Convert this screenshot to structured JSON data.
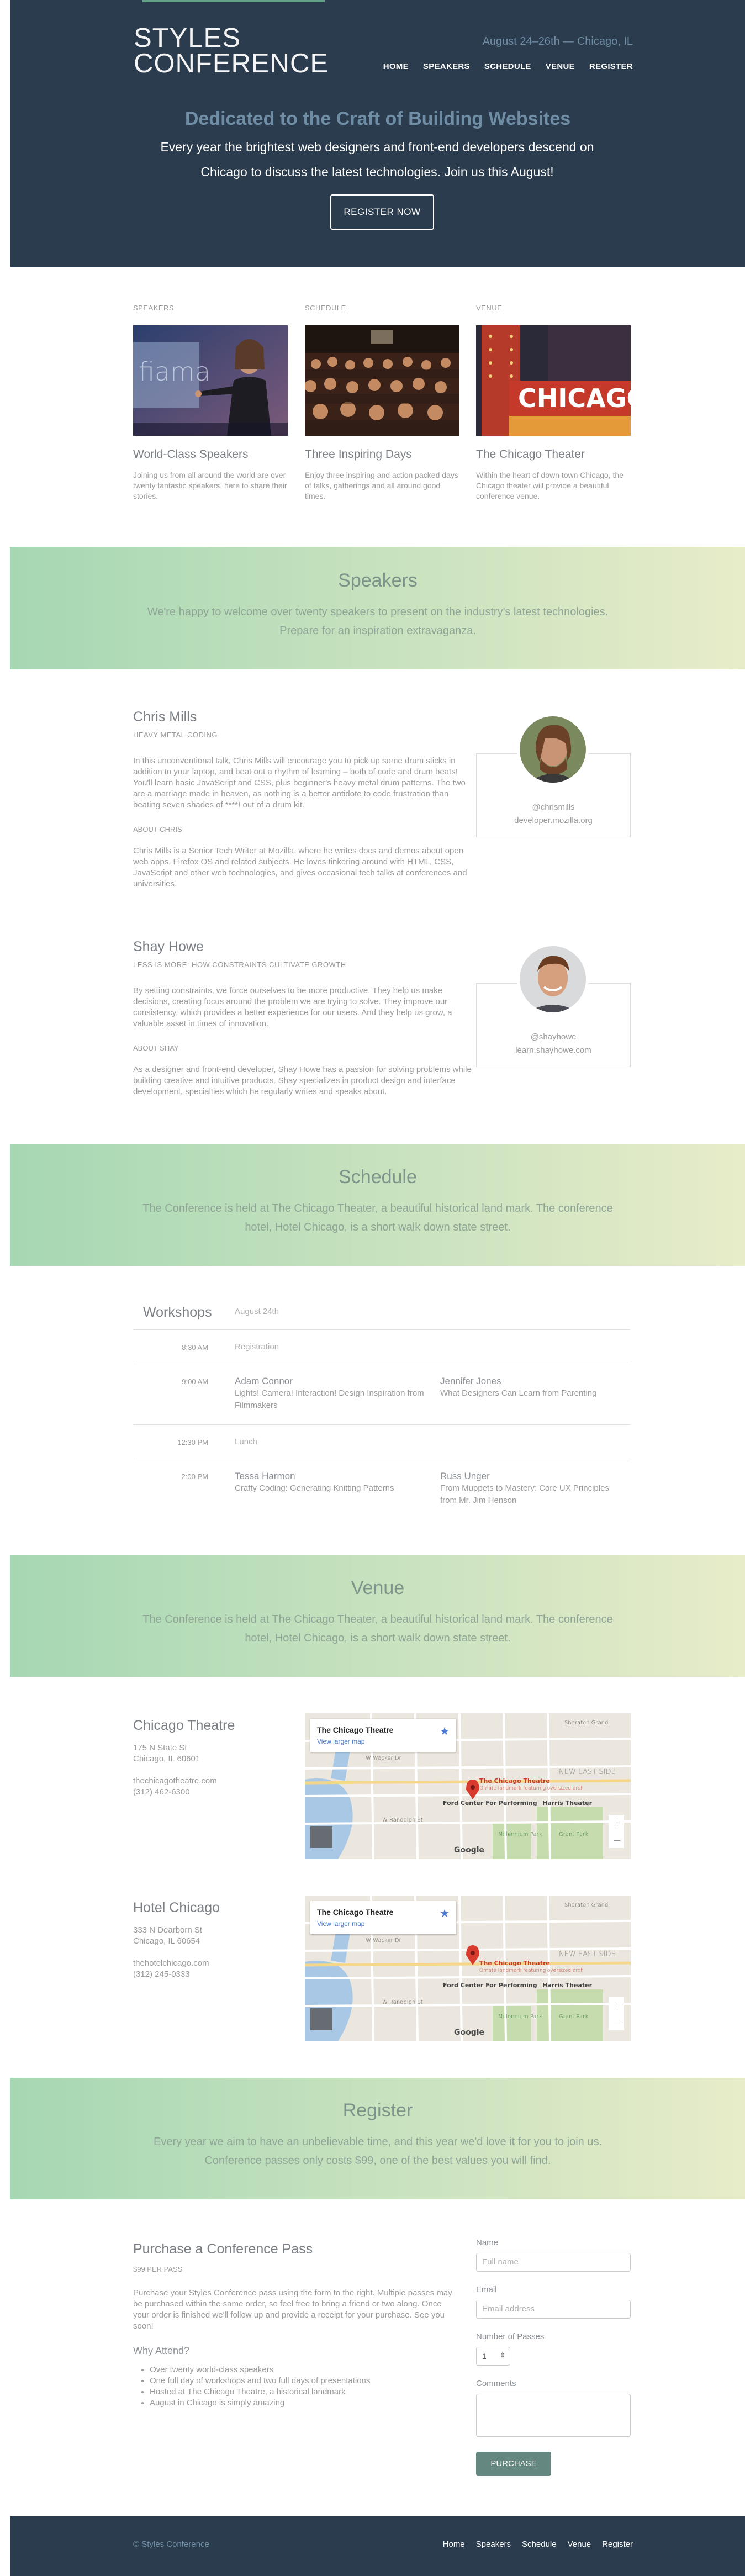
{
  "header": {
    "logo_line1": "STYLES",
    "logo_line2": "CONFERENCE",
    "tagline": "August 24–26th — Chicago, IL",
    "nav": [
      "HOME",
      "SPEAKERS",
      "SCHEDULE",
      "VENUE",
      "REGISTER"
    ]
  },
  "hero": {
    "title": "Dedicated to the Craft of Building Websites",
    "subtitle": "Every year the brightest web designers and front-end developers descend on Chicago to discuss the latest technologies. Join us this August!",
    "button": "REGISTER NOW"
  },
  "teasers": [
    {
      "category": "SPEAKERS",
      "title": "World-Class Speakers",
      "text": "Joining us from all around the world are over twenty fantastic speakers, here to share their stories."
    },
    {
      "category": "SCHEDULE",
      "title": "Three Inspiring Days",
      "text": "Enjoy three inspiring and action packed days of talks, gatherings and all around good times."
    },
    {
      "category": "VENUE",
      "title": "The Chicago Theater",
      "text": "Within the heart of down town Chicago, the Chicago theater will provide a beautiful conference venue."
    }
  ],
  "speakers_banner": {
    "title": "Speakers",
    "text": "We're happy to welcome over twenty speakers to present on the industry's latest technologies. Prepare for an inspiration extravaganza."
  },
  "speakers": [
    {
      "name": "Chris Mills",
      "session": "HEAVY METAL CODING",
      "body": "In this unconventional talk, Chris Mills will encourage you to pick up some drum sticks in addition to your laptop, and beat out a rhythm of learning – both of code and drum beats! You'll learn basic JavaScript and CSS, plus beginner's heavy metal drum patterns. The two are a marriage made in heaven, as nothing is a better antidote to code frustration than beating seven shades of ****! out of a drum kit.",
      "about_label": "ABOUT CHRIS",
      "bio": "Chris Mills is a Senior Tech Writer at Mozilla, where he writes docs and demos about open web apps, Firefox OS and related subjects. He loves tinkering around with HTML, CSS, JavaScript and other web technologies, and gives occasional tech talks at conferences and universities.",
      "handle": "@chrismills",
      "site": "developer.mozilla.org"
    },
    {
      "name": "Shay Howe",
      "session": "LESS IS MORE: HOW CONSTRAINTS CULTIVATE GROWTH",
      "body": "By setting constraints, we force ourselves to be more productive. They help us make decisions, creating focus around the problem we are trying to solve. They improve our consistency, which provides a better experience for our users. And they help us grow, a valuable asset in times of innovation.",
      "about_label": "ABOUT SHAY",
      "bio": "As a designer and front-end developer, Shay Howe has a passion for solving problems while building creative and intuitive products. Shay specializes in product design and interface development, specialties which he regularly writes and speaks about.",
      "handle": "@shayhowe",
      "site": "learn.shayhowe.com"
    }
  ],
  "schedule_banner": {
    "title": "Schedule",
    "text": "The Conference is held at The Chicago Theater, a beautiful historical land mark. The conference hotel, Hotel Chicago, is a short walk down state street."
  },
  "schedule": {
    "title": "Workshops",
    "date": "August 24th",
    "rows": [
      {
        "time": "8:30 AM",
        "plain": "Registration"
      },
      {
        "time": "9:00 AM",
        "sessions": [
          {
            "speaker": "Adam Connor",
            "title": "Lights! Camera! Interaction! Design Inspiration from Filmmakers"
          },
          {
            "speaker": "Jennifer Jones",
            "title": "What Designers Can Learn from Parenting"
          }
        ]
      },
      {
        "time": "12:30 PM",
        "plain": "Lunch"
      },
      {
        "time": "2:00 PM",
        "sessions": [
          {
            "speaker": "Tessa Harmon",
            "title": "Crafty Coding: Generating Knitting Patterns"
          },
          {
            "speaker": "Russ Unger",
            "title": "From Muppets to Mastery: Core UX Principles from Mr. Jim Henson"
          }
        ]
      }
    ]
  },
  "venue_banner": {
    "title": "Venue",
    "text": "The Conference is held at The Chicago Theater, a beautiful historical land mark. The conference hotel, Hotel Chicago, is a short walk down state street."
  },
  "venues": [
    {
      "name": "Chicago Theatre",
      "street": "175 N State St",
      "city": "Chicago, IL 60601",
      "web": "thechicagotheatre.com",
      "phone": "(312) 462-6300"
    },
    {
      "name": "Hotel Chicago",
      "street": "333 N Dearborn St",
      "city": "Chicago, IL 60654",
      "web": "thehotelchicago.com",
      "phone": "(312) 245-0333"
    }
  ],
  "map": {
    "card_title": "The Chicago Theatre",
    "card_link": "View larger map",
    "labels": [
      "W Wacker Dr",
      "Sheraton Grand",
      "The Chicago Theatre",
      "Ornate landmark featuring oversized arch",
      "Ford Center For Performing",
      "Harris Theater",
      "NEW EAST SIDE",
      "Millennium Park",
      "Grant Park",
      "W Randolph St",
      "Google"
    ],
    "zoom_in": "+",
    "zoom_out": "−"
  },
  "register_banner": {
    "title": "Register",
    "text": "Every year we aim to have an unbelievable time, and this year we'd love it for you to join us. Conference passes only costs $99, one of the best values you will find."
  },
  "register": {
    "title": "Purchase a Conference Pass",
    "price": "$99 PER PASS",
    "desc": "Purchase your Styles Conference pass using the form to the right. Multiple passes may be purchased within the same order, so feel free to bring a friend or two along. Once your order is finished we'll follow up and provide a receipt for your purchase. See you soon!",
    "why_title": "Why Attend?",
    "reasons": [
      "Over twenty world-class speakers",
      "One full day of workshops and two full days of presentations",
      "Hosted at The Chicago Theatre, a historical landmark",
      "August in Chicago is simply amazing"
    ]
  },
  "form": {
    "name_label": "Name",
    "name_placeholder": "Full name",
    "email_label": "Email",
    "email_placeholder": "Email address",
    "passes_label": "Number of Passes",
    "passes_value": "1",
    "comments_label": "Comments",
    "submit": "PURCHASE"
  },
  "footer": {
    "copyright": "© Styles Conference",
    "nav": [
      "Home",
      "Speakers",
      "Schedule",
      "Venue",
      "Register"
    ]
  },
  "colors": {
    "navy": "#2a3c4e",
    "accent": "#648880",
    "gradient_start": "#a6d7b3",
    "gradient_end": "#e8ecc9"
  }
}
